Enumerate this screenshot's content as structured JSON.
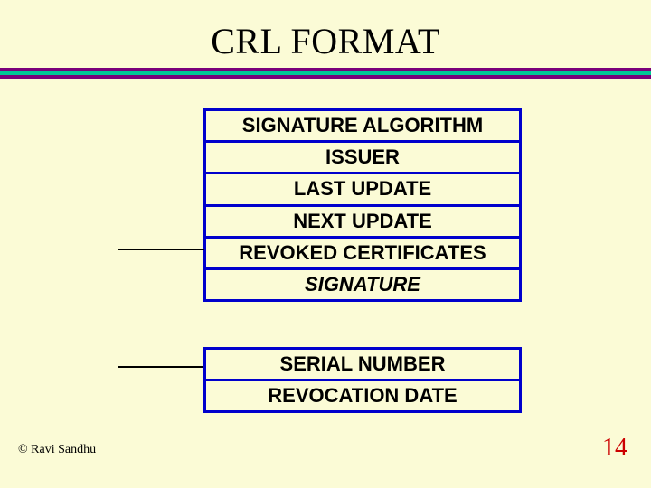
{
  "title": "CRL FORMAT",
  "fields": {
    "sig_alg": "SIGNATURE ALGORITHM",
    "issuer": "ISSUER",
    "last_update": "LAST UPDATE",
    "next_update": "NEXT UPDATE",
    "revoked": "REVOKED CERTIFICATES",
    "signature": "SIGNATURE"
  },
  "sub_fields": {
    "serial": "SERIAL NUMBER",
    "rev_date": "REVOCATION DATE"
  },
  "footer": {
    "copyright": "© Ravi Sandhu",
    "page": "14"
  }
}
